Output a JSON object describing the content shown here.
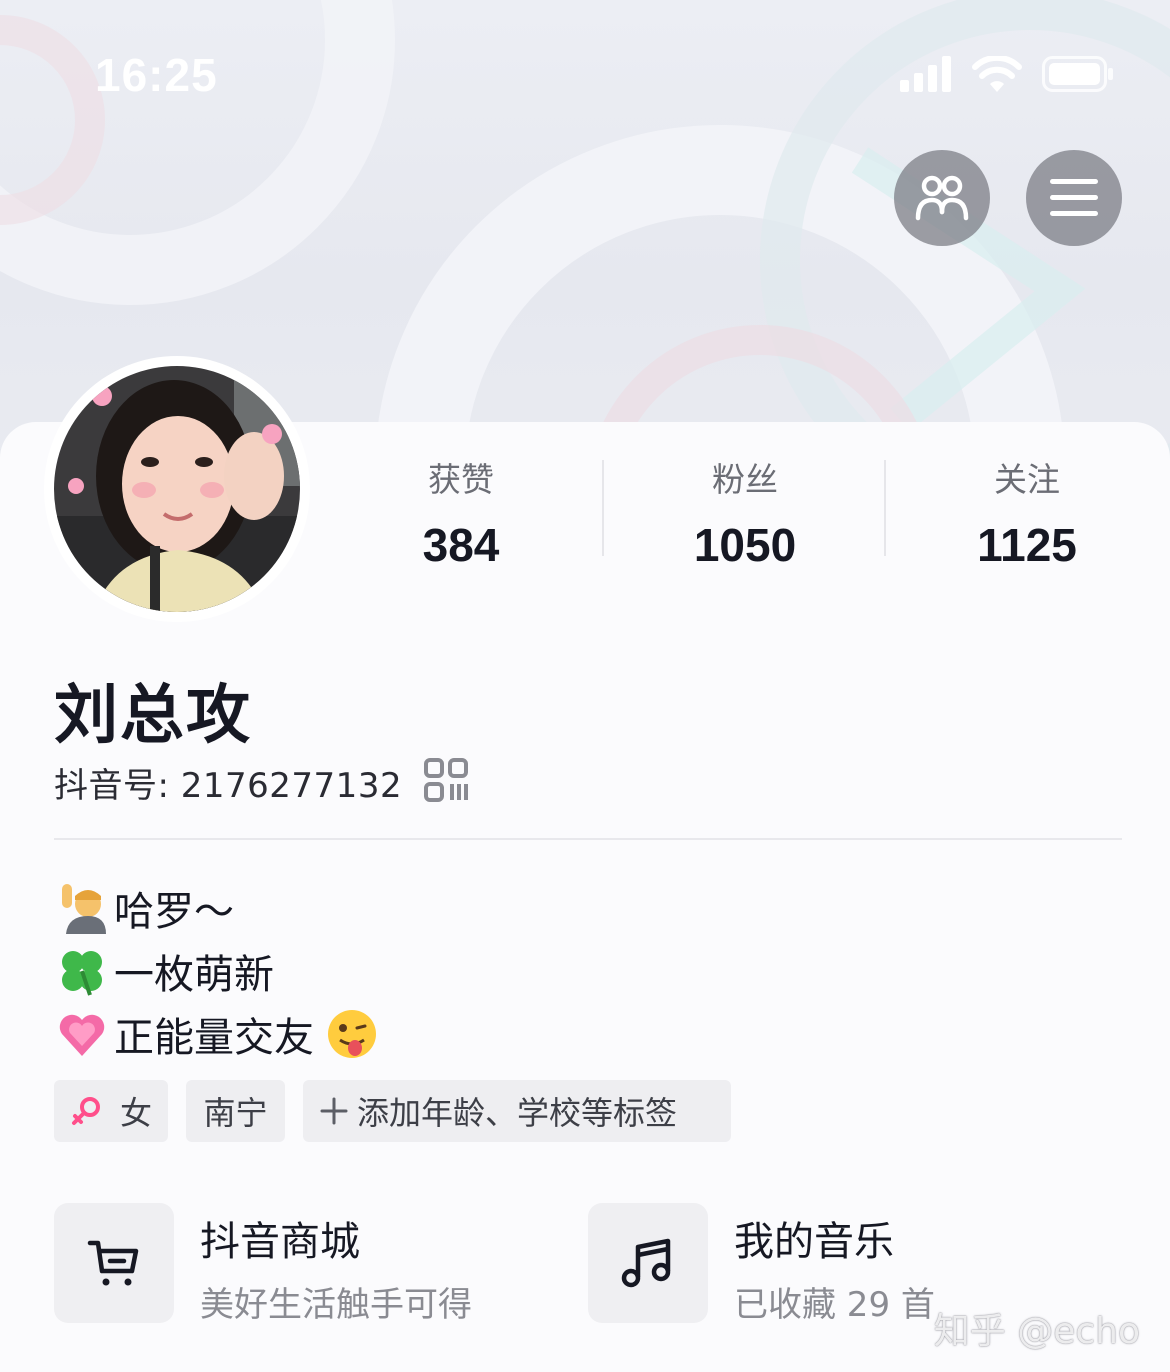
{
  "status_bar": {
    "time": "16:25"
  },
  "header": {
    "friends_icon": "friends-icon",
    "menu_icon": "hamburger-menu-icon"
  },
  "profile": {
    "nickname": "刘总攻",
    "douyin_id": "抖音号: 2176277132",
    "stats": [
      {
        "label": "获赞",
        "value": "384"
      },
      {
        "label": "粉丝",
        "value": "1050"
      },
      {
        "label": "关注",
        "value": "1125"
      }
    ],
    "bio": [
      {
        "emoji": "raising-hand-emoji",
        "text": " 哈罗～"
      },
      {
        "emoji": "four-leaf-clover-emoji",
        "text": "一枚萌新"
      },
      {
        "emoji": "growing-heart-emoji",
        "text": "正能量交友 ",
        "trailing_emoji": "winking-tongue-emoji"
      }
    ],
    "tags": {
      "gender": "女",
      "city": "南宁",
      "add": "添加年龄、学校等标签"
    }
  },
  "shortcuts": {
    "mall": {
      "title": "抖音商城",
      "subtitle": "美好生活触手可得",
      "icon": "cart-icon"
    },
    "music": {
      "title": "我的音乐",
      "subtitle": "已收藏 29 首",
      "icon": "music-note-icon"
    }
  },
  "watermark": "知乎 @echo",
  "colors": {
    "background": "#fbfbfd",
    "text": "#161823",
    "tag_bg": "#eeeef1",
    "female_pink": "#ff4f8b"
  }
}
